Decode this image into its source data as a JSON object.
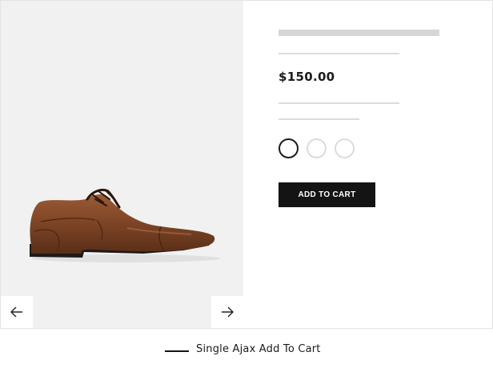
{
  "product": {
    "price": "$150.00",
    "add_to_cart_label": "ADD TO CART",
    "image_name": "brown-leather-oxford-shoe",
    "swatches": [
      {
        "name": "black-outline",
        "selected": true
      },
      {
        "name": "light-outline",
        "selected": false
      },
      {
        "name": "light-outline",
        "selected": false
      }
    ]
  },
  "gallery": {
    "prev_icon": "arrow-left-icon",
    "next_icon": "arrow-right-icon"
  },
  "caption": {
    "text": "Single Ajax Add To Cart"
  },
  "colors": {
    "gallery_bg": "#f1f1f1",
    "button_bg": "#141414",
    "skeleton": "#d6d6d6",
    "divider": "#dcdcdc"
  }
}
